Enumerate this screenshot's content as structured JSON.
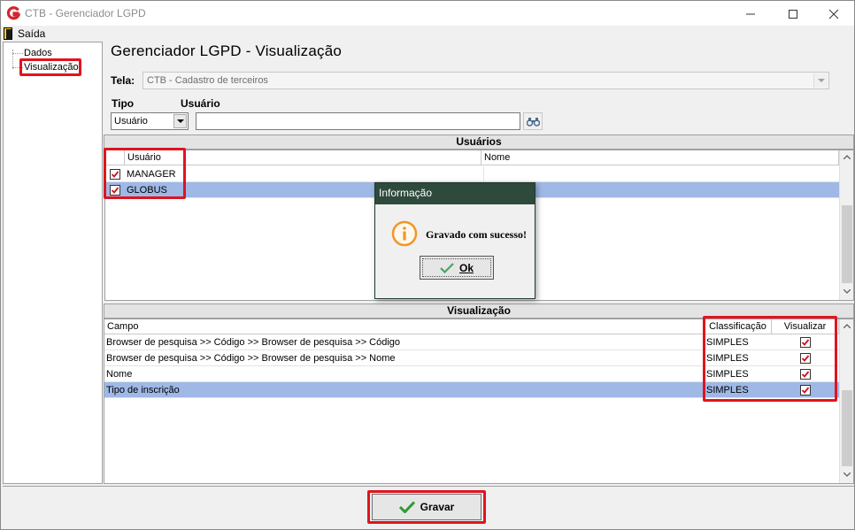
{
  "window": {
    "title": "CTB - Gerenciador LGPD"
  },
  "menu": {
    "exit_label": "Saída"
  },
  "sidebar": {
    "items": [
      {
        "label": "Dados"
      },
      {
        "label": "Visualização"
      }
    ]
  },
  "main": {
    "title": "Gerenciador LGPD - Visualização",
    "tela_label": "Tela:",
    "tela_value": "CTB - Cadastro de terceiros",
    "tipo_label": "Tipo",
    "usuario_label": "Usuário",
    "tipo_value": "Usuário",
    "usuario_value": ""
  },
  "usuarios": {
    "header": "Usuários",
    "columns": [
      "Usuário",
      "Nome"
    ],
    "rows": [
      {
        "checked": true,
        "usuario": "MANAGER",
        "nome": ""
      },
      {
        "checked": true,
        "usuario": "GLOBUS",
        "nome": "",
        "selected": true
      }
    ]
  },
  "visualizacao": {
    "header": "Visualização",
    "columns": [
      "Campo",
      "Classificação",
      "Visualizar"
    ],
    "rows": [
      {
        "campo": "Browser de pesquisa >> Código >> Browser de pesquisa >> Código",
        "classificacao": "SIMPLES",
        "visualizar": true
      },
      {
        "campo": "Browser de pesquisa >> Código >> Browser de pesquisa >> Nome",
        "classificacao": "SIMPLES",
        "visualizar": true
      },
      {
        "campo": "Nome",
        "classificacao": "SIMPLES",
        "visualizar": true
      },
      {
        "campo": "Tipo de inscrição",
        "classificacao": "SIMPLES",
        "visualizar": true,
        "selected": true
      }
    ]
  },
  "footer": {
    "gravar_label": "Gravar"
  },
  "dialog": {
    "title": "Informação",
    "message": "Gravado com sucesso!",
    "ok_label": "Ok"
  },
  "colors": {
    "highlight_red": "#e0141e",
    "selection_blue": "#9fb8e6",
    "dialog_title_bg": "#2d4a3c",
    "info_orange": "#f0962a",
    "check_green": "#3a9a3a"
  }
}
